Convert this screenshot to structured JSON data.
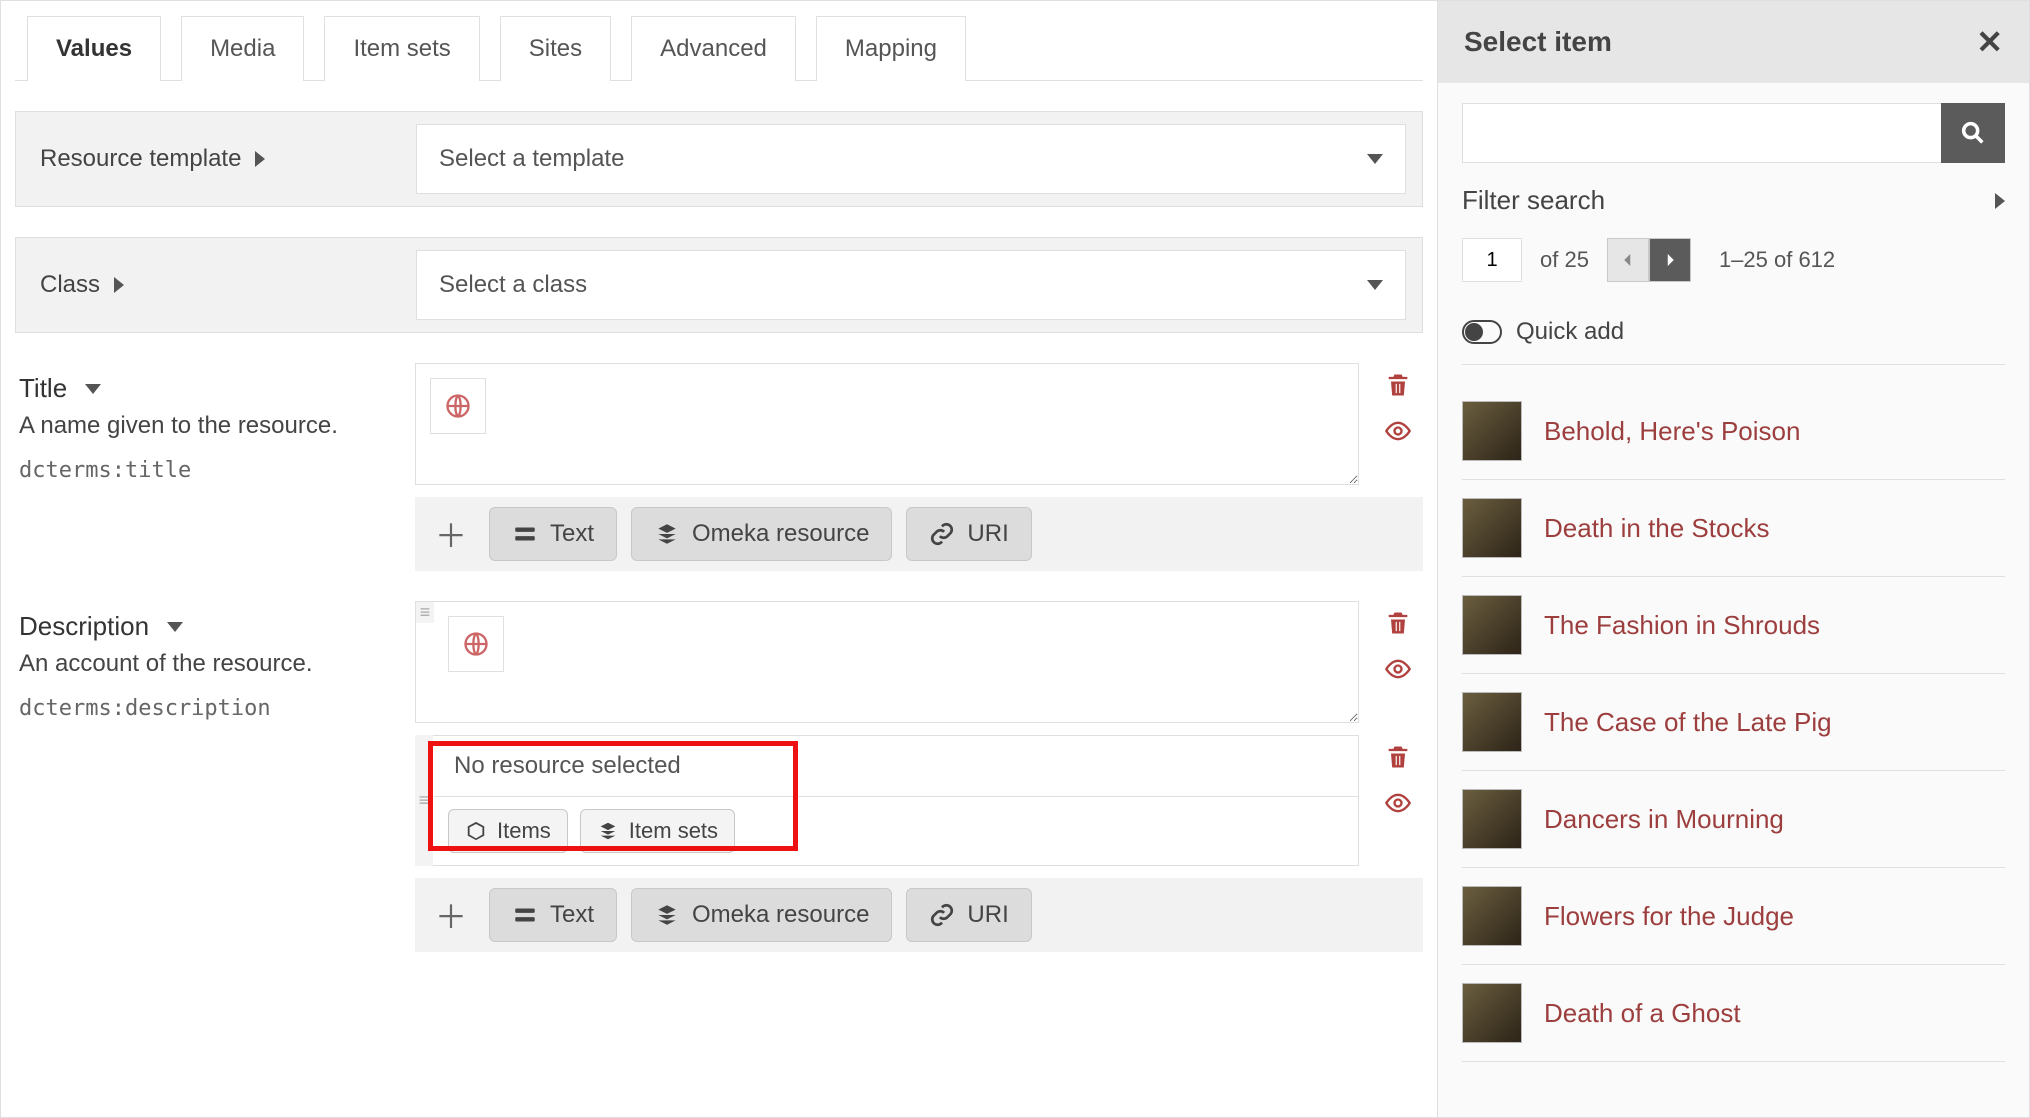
{
  "tabs": {
    "values": "Values",
    "media": "Media",
    "item_sets": "Item sets",
    "sites": "Sites",
    "advanced": "Advanced",
    "mapping": "Mapping"
  },
  "template_row": {
    "label": "Resource template",
    "placeholder": "Select a template"
  },
  "class_row": {
    "label": "Class",
    "placeholder": "Select a class"
  },
  "title": {
    "name": "Title",
    "desc": "A name given to the resource.",
    "term": "dcterms:title"
  },
  "description": {
    "name": "Description",
    "desc": "An account of the resource.",
    "term": "dcterms:description",
    "no_resource": "No resource selected",
    "items_btn": "Items",
    "item_sets_btn": "Item sets"
  },
  "type_buttons": {
    "text": "Text",
    "omeka": "Omeka resource",
    "uri": "URI"
  },
  "side": {
    "heading": "Select item",
    "filter": "Filter search",
    "page_current": "1",
    "page_of": "of 25",
    "range": "1–25 of 612",
    "quick_add": "Quick add",
    "items": [
      "Behold, Here's Poison",
      "Death in the Stocks",
      "The Fashion in Shrouds",
      "The Case of the Late Pig",
      "Dancers in Mourning",
      "Flowers for the Judge",
      "Death of a Ghost"
    ]
  }
}
